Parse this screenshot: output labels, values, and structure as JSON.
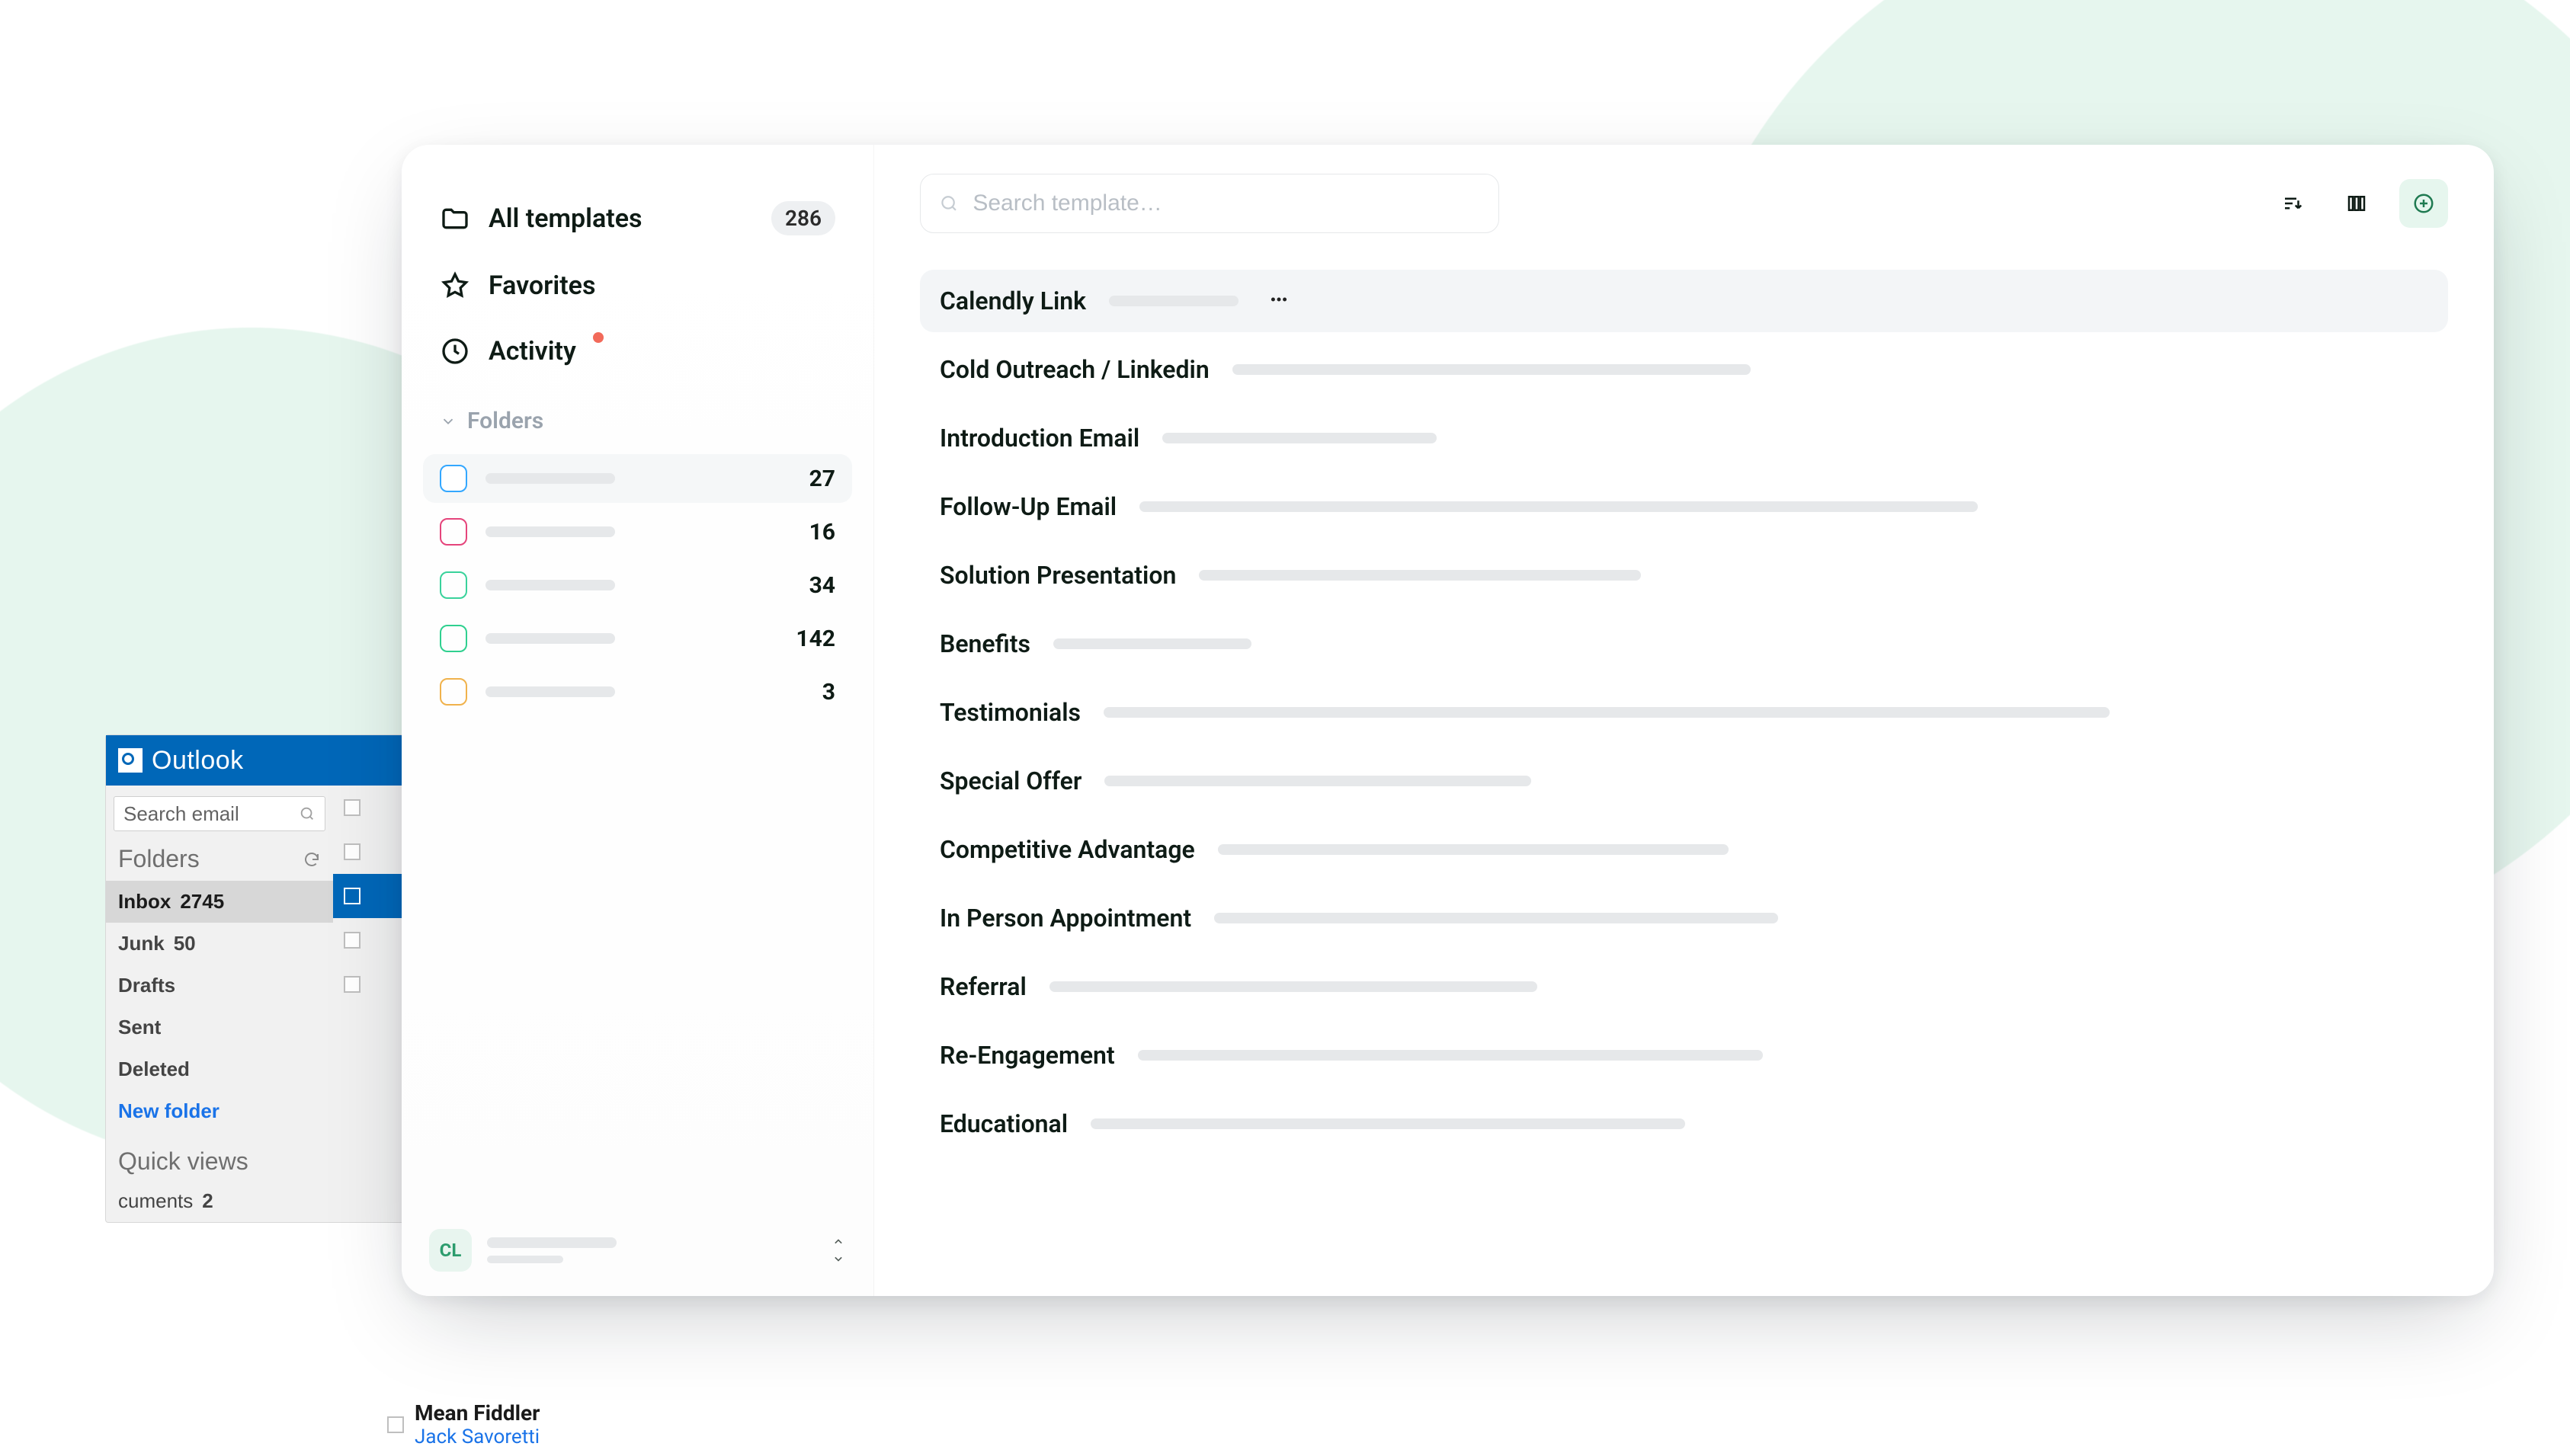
{
  "outlook": {
    "brand": "Outlook",
    "search_placeholder": "Search email",
    "folders_label": "Folders",
    "items": [
      {
        "label": "Inbox",
        "count": "2745"
      },
      {
        "label": "Junk",
        "count": "50"
      },
      {
        "label": "Drafts"
      },
      {
        "label": "Sent"
      },
      {
        "label": "Deleted"
      },
      {
        "label": "New folder"
      }
    ],
    "quick_views": "Quick views",
    "quick_items": [
      {
        "label": "cuments",
        "count": "2"
      }
    ],
    "extra": {
      "name": "Mean Fiddler",
      "sender": "Jack Savoretti"
    }
  },
  "sidebar": {
    "nav": [
      {
        "label": "All templates",
        "count": "286"
      },
      {
        "label": "Favorites"
      },
      {
        "label": "Activity",
        "hasDot": true
      }
    ],
    "folders_label": "Folders",
    "folders": [
      {
        "color": "#33a7ff",
        "count": "27"
      },
      {
        "color": "#e5447b",
        "count": "16"
      },
      {
        "color": "#39d29b",
        "count": "34"
      },
      {
        "color": "#2fd08f",
        "count": "142"
      },
      {
        "color": "#f0b24c",
        "count": "3"
      }
    ],
    "profile": {
      "initials": "CL"
    }
  },
  "toolbar": {
    "search_placeholder": "Search template…"
  },
  "templates": [
    {
      "title": "Calendly Link",
      "selected": true,
      "ghost_class": "w1"
    },
    {
      "title": "Cold Outreach / Linkedin",
      "ghost_class": "w2"
    },
    {
      "title": "Introduction Email",
      "ghost_class": "w3"
    },
    {
      "title": "Follow-Up Email",
      "ghost_class": "w4"
    },
    {
      "title": "Solution Presentation",
      "ghost_class": "w5"
    },
    {
      "title": "Benefits",
      "ghost_class": "w6"
    },
    {
      "title": "Testimonials",
      "ghost_class": "w7"
    },
    {
      "title": "Special Offer",
      "ghost_class": "w8"
    },
    {
      "title": "Competitive Advantage",
      "ghost_class": "w9"
    },
    {
      "title": "In Person Appointment",
      "ghost_class": "w10"
    },
    {
      "title": "Referral",
      "ghost_class": "w11"
    },
    {
      "title": "Re-Engagement",
      "ghost_class": "w12"
    },
    {
      "title": "Educational",
      "ghost_class": "w13"
    }
  ]
}
